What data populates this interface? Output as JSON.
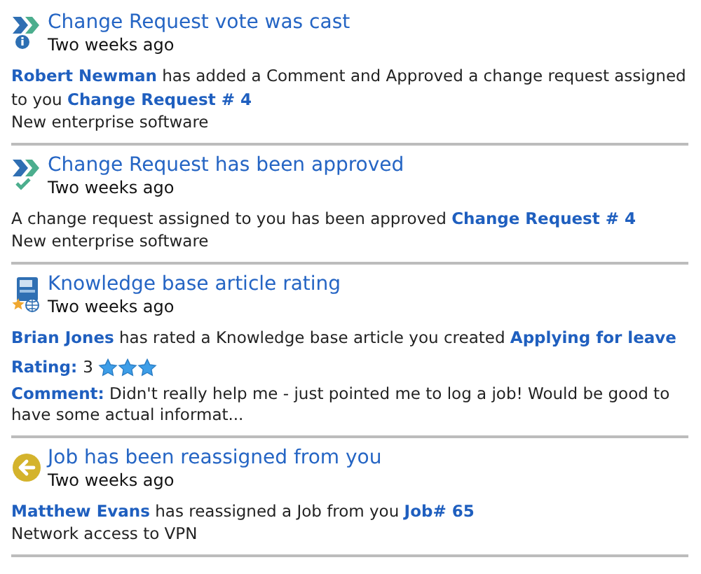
{
  "notifications": [
    {
      "kind": "vote",
      "title": "Change Request vote was cast",
      "time": "Two weeks ago",
      "message": [
        {
          "kind": "link",
          "text": "Robert Newman"
        },
        {
          "kind": "text",
          "text": " has added a Comment and Approved a change request assigned to you "
        },
        {
          "kind": "link",
          "text": "Change Request # 4"
        }
      ],
      "subject": "New enterprise software"
    },
    {
      "kind": "approved",
      "title": "Change Request has been approved",
      "time": "Two weeks ago",
      "message": [
        {
          "kind": "text",
          "text": "A change request assigned to you has been approved "
        },
        {
          "kind": "link",
          "text": "Change Request # 4"
        }
      ],
      "subject": "New enterprise software"
    },
    {
      "kind": "rating",
      "title": "Knowledge base article rating",
      "time": "Two weeks ago",
      "message": [
        {
          "kind": "link",
          "text": "Brian Jones"
        },
        {
          "kind": "text",
          "text": " has rated a Knowledge base article you created "
        },
        {
          "kind": "link",
          "text": "Applying for leave"
        }
      ],
      "rating": {
        "label": "Rating:",
        "value": "3",
        "stars": 3
      },
      "comment": {
        "label": "Comment:",
        "text": "Didn't really help me - just pointed me to log a job! Would be good to have some actual informat..."
      }
    },
    {
      "kind": "reassigned",
      "title": "Job has been reassigned from you",
      "time": "Two weeks ago",
      "message": [
        {
          "kind": "link",
          "text": "Matthew Evans"
        },
        {
          "kind": "text",
          "text": " has reassigned a Job from you "
        },
        {
          "kind": "link",
          "text": "Job# 65"
        }
      ],
      "subject": "Network access to VPN"
    }
  ]
}
